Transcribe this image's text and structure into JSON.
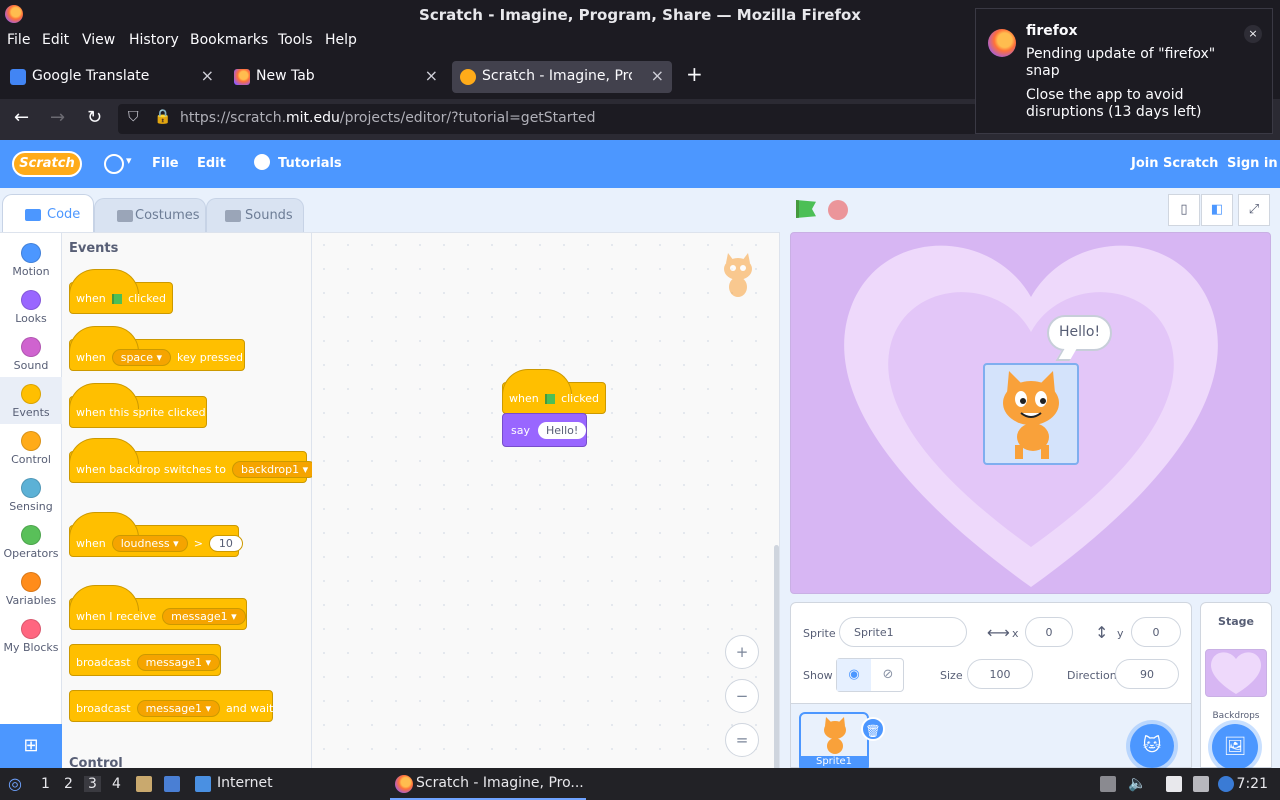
{
  "window": {
    "title": "Scratch - Imagine, Program, Share — Mozilla Firefox"
  },
  "menubar": [
    "File",
    "Edit",
    "View",
    "History",
    "Bookmarks",
    "Tools",
    "Help"
  ],
  "tabs": [
    {
      "label": "Google Translate",
      "active": false
    },
    {
      "label": "New Tab",
      "active": false
    },
    {
      "label": "Scratch - Imagine, Progra",
      "active": true
    }
  ],
  "urlbar": {
    "prefix": "https://scratch.",
    "domain": "mit.edu",
    "path": "/projects/editor/?tutorial=getStarted"
  },
  "notification": {
    "app": "firefox",
    "line1": "Pending update of \"firefox\" snap",
    "line2": "Close the app to avoid disruptions (13 days left)",
    "close": "×"
  },
  "scratch": {
    "logo": "Scratch",
    "menu": {
      "file": "File",
      "edit": "Edit",
      "tutorials": "Tutorials",
      "join": "Join Scratch",
      "signin": "Sign in"
    },
    "editor_tabs": {
      "code": "Code",
      "costumes": "Costumes",
      "sounds": "Sounds"
    },
    "categories": [
      {
        "label": "Motion",
        "color": "#4c97ff"
      },
      {
        "label": "Looks",
        "color": "#9966ff"
      },
      {
        "label": "Sound",
        "color": "#cf63cf"
      },
      {
        "label": "Events",
        "color": "#ffbf00"
      },
      {
        "label": "Control",
        "color": "#ffab19"
      },
      {
        "label": "Sensing",
        "color": "#5cb1d6"
      },
      {
        "label": "Operators",
        "color": "#59c059"
      },
      {
        "label": "Variables",
        "color": "#ff8c1a"
      },
      {
        "label": "My Blocks",
        "color": "#ff6680"
      }
    ],
    "flyout": {
      "heading": "Events",
      "heading2": "Control",
      "blocks": {
        "flag_when": "when",
        "flag_clicked": "clicked",
        "key_when": "when",
        "key_value": "space",
        "key_pressed": "key pressed",
        "sprite_clicked": "when this sprite clicked",
        "backdrop_text": "when backdrop switches to",
        "backdrop_value": "backdrop1",
        "loud_when": "when",
        "loud_value": "loudness",
        "loud_op": ">",
        "loud_num": "10",
        "receive_text": "when I receive",
        "receive_value": "message1",
        "broadcast_text": "broadcast",
        "broadcast_value": "message1",
        "broadcast_wait_text": "broadcast",
        "broadcast_wait_value": "message1",
        "broadcast_wait_tail": "and wait"
      }
    },
    "script": {
      "when": "when",
      "clicked": "clicked",
      "say": "say",
      "say_value": "Hello!"
    },
    "zoom": {
      "in": "+",
      "out": "−",
      "reset": "="
    },
    "stage": {
      "speech": "Hello!"
    },
    "sprite_info": {
      "sprite_label": "Sprite",
      "sprite_name": "Sprite1",
      "x_label": "x",
      "x_value": "0",
      "y_label": "y",
      "y_value": "0",
      "show_label": "Show",
      "size_label": "Size",
      "size_value": "100",
      "direction_label": "Direction",
      "direction_value": "90"
    },
    "sprite_thumb": "Sprite1",
    "stage_panel": {
      "title": "Stage",
      "backdrops": "Backdrops"
    }
  },
  "taskbar": {
    "workspaces": [
      "1",
      "2",
      "3",
      "4"
    ],
    "folder": "Internet",
    "app": "Scratch - Imagine, Pro...",
    "clock": "7:21"
  }
}
